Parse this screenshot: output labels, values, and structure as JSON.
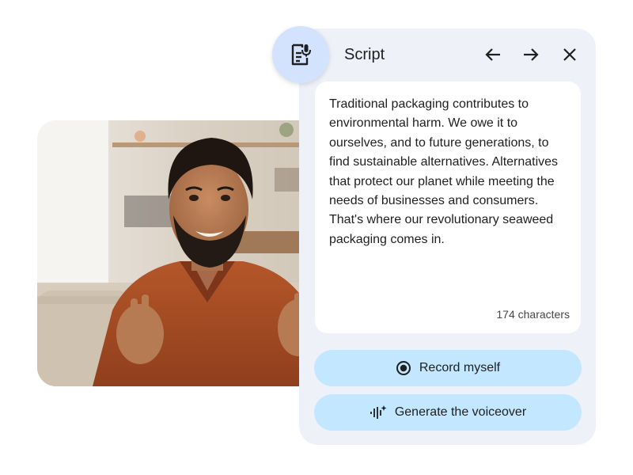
{
  "panel": {
    "title": "Script",
    "script_text": "Traditional packaging contributes to environmental harm. We owe it to ourselves, and to future generations, to find sustainable alternatives. Alternatives that protect our planet while meeting the needs of businesses and consumers. That's where our revolutionary seaweed packaging comes in.",
    "character_count": "174 characters",
    "icons": {
      "script": "script-mic-icon",
      "back": "arrow-left-icon",
      "forward": "arrow-right-icon",
      "close": "close-icon"
    }
  },
  "actions": {
    "record_label": "Record myself",
    "record_icon": "record-icon",
    "generate_label": "Generate the voiceover",
    "generate_icon": "voice-sparkle-icon"
  },
  "colors": {
    "panel_bg": "#eef2f8",
    "icon_circle": "#d3e3fd",
    "button_bg": "#c2e7ff",
    "text": "#1f1f1f"
  }
}
